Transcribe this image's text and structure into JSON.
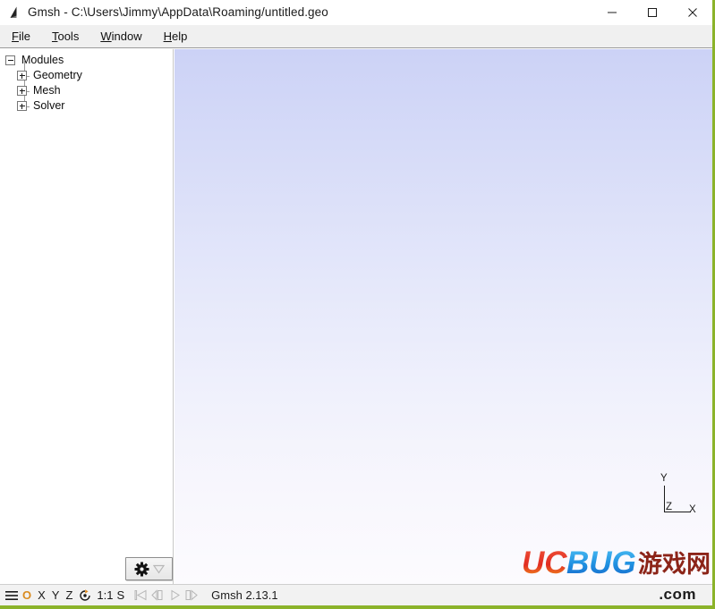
{
  "window": {
    "title": "Gmsh - C:\\Users\\Jimmy\\AppData\\Roaming/untitled.geo",
    "icon": "gmsh-cone-icon",
    "controls": {
      "minimize": "minimize-icon",
      "maximize": "maximize-icon",
      "close": "close-icon"
    }
  },
  "menubar": {
    "items": [
      {
        "label": "File",
        "mnemonic": "F",
        "rest": "ile"
      },
      {
        "label": "Tools",
        "mnemonic": "T",
        "rest": "ools"
      },
      {
        "label": "Window",
        "mnemonic": "W",
        "rest": "indow"
      },
      {
        "label": "Help",
        "mnemonic": "H",
        "rest": "elp"
      }
    ]
  },
  "tree": {
    "root": {
      "label": "Modules",
      "state": "expanded",
      "toggle": "minus"
    },
    "children": [
      {
        "label": "Geometry",
        "state": "collapsed",
        "toggle": "plus"
      },
      {
        "label": "Mesh",
        "state": "collapsed",
        "toggle": "plus"
      },
      {
        "label": "Solver",
        "state": "collapsed",
        "toggle": "plus"
      }
    ],
    "gear_button": {
      "icon": "gear-icon",
      "dropdown_icon": "triangle-down-icon",
      "enabled": true
    }
  },
  "canvas": {
    "background_top": "#ccd2f6",
    "background_bottom": "#fcfbfe",
    "axes": {
      "y": "Y",
      "x": "X",
      "z": "Z"
    },
    "watermark": {
      "uc": "UC",
      "bug": "BUG",
      "cn": "游戏网",
      "dotcom": ".com",
      "uc_color": "#e8302a",
      "bug_color": "#1f9fe8",
      "cn_color": "#8c2418"
    }
  },
  "statusbar": {
    "menu_icon": "hamburger-menu-icon",
    "orientation_reset": "O",
    "axis_x": "X",
    "axis_y": "Y",
    "axis_z": "Z",
    "rotate_icon": "rotate-icon",
    "scale": "1:1",
    "selection": "S",
    "playback": [
      {
        "name": "skip-to-start-icon",
        "enabled": false
      },
      {
        "name": "step-back-icon",
        "enabled": false
      },
      {
        "name": "play-icon",
        "enabled": false
      },
      {
        "name": "step-forward-icon",
        "enabled": false
      }
    ],
    "version": "Gmsh 2.13.1"
  },
  "theme": {
    "accent_green": "#8bb32a",
    "orange": "#d98b1f",
    "menubar_bg": "#f0f0f0",
    "statusbar_bg": "#f2f2f2"
  }
}
